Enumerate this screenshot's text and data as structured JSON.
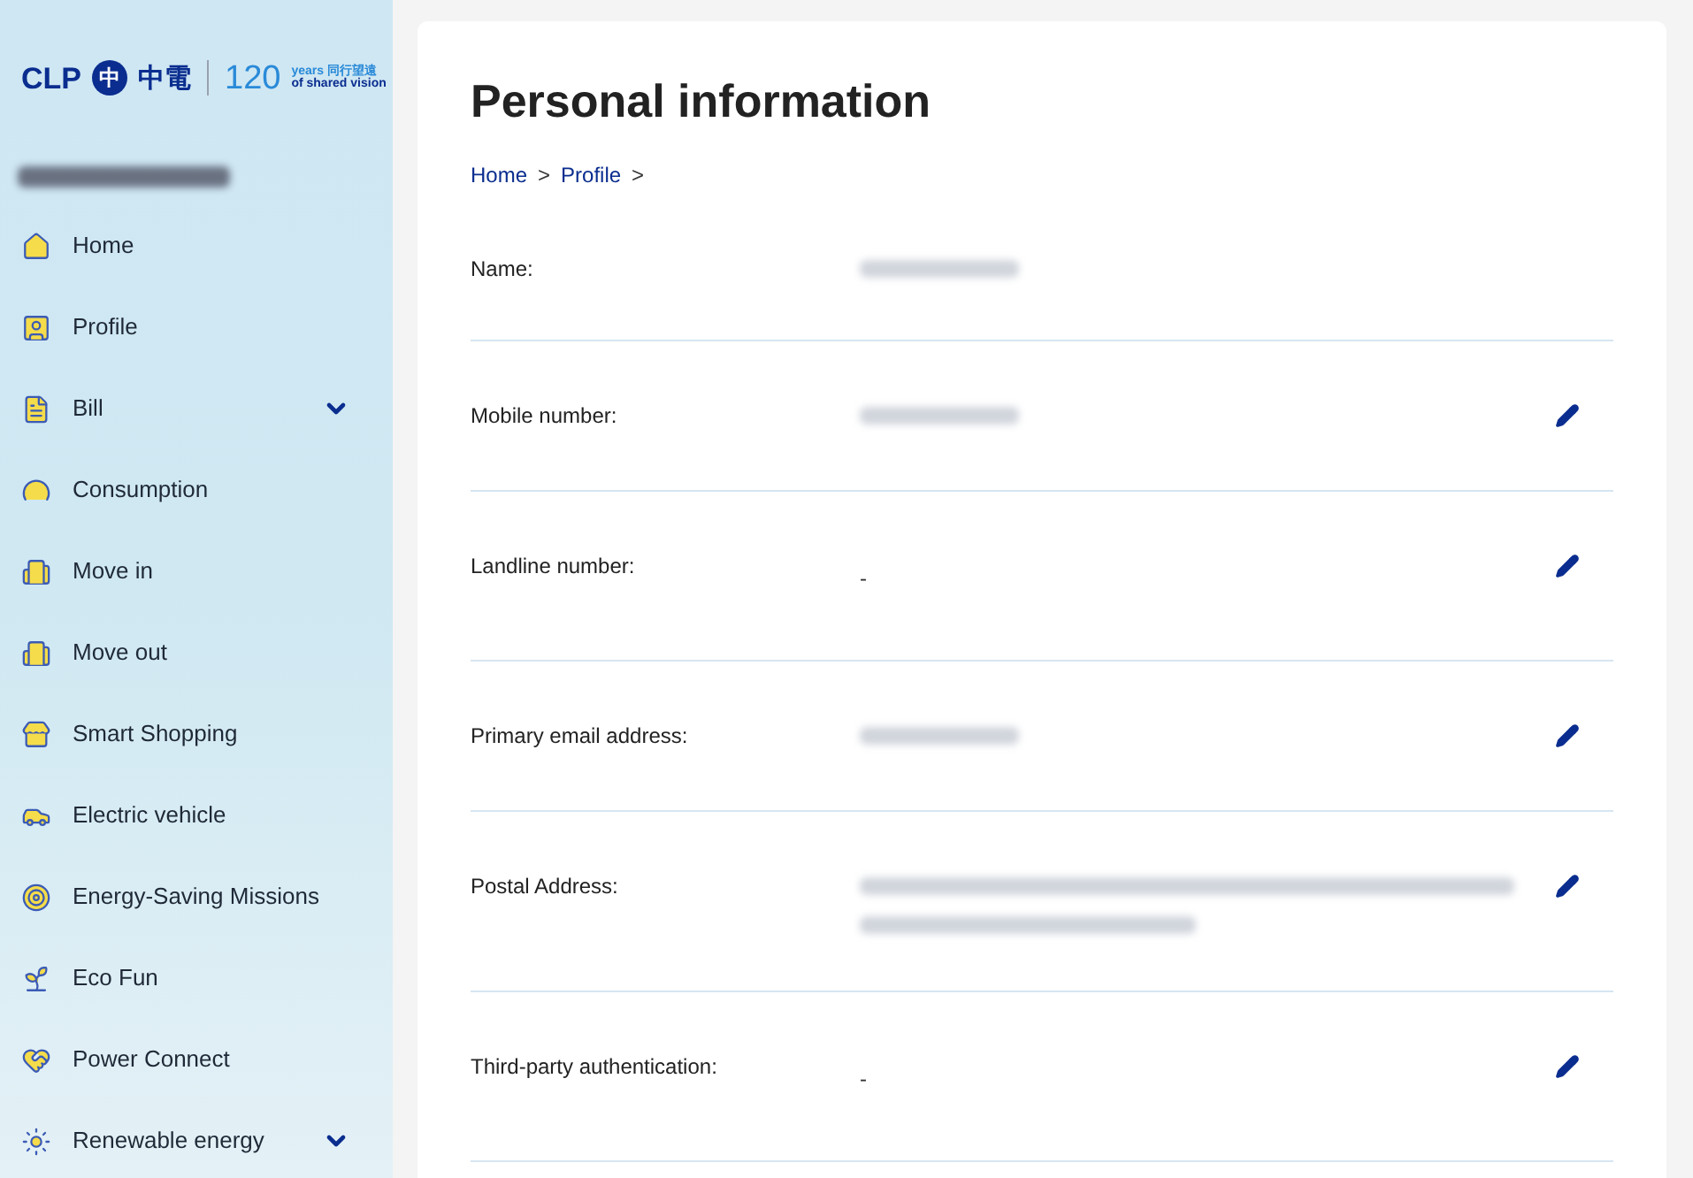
{
  "logo": {
    "brand": "CLP",
    "mark": "中",
    "chinese": "中電",
    "anniversary": "120",
    "tagline_top": "years 同行望遠",
    "tagline_bottom": "of shared vision"
  },
  "sidebar": {
    "items": [
      {
        "label": "Home",
        "kind": "link"
      },
      {
        "label": "Profile",
        "kind": "link"
      },
      {
        "label": "Bill",
        "kind": "group"
      },
      {
        "label": "Consumption",
        "kind": "link"
      },
      {
        "label": "Move in",
        "kind": "link"
      },
      {
        "label": "Move out",
        "kind": "link"
      },
      {
        "label": "Smart Shopping",
        "kind": "link"
      },
      {
        "label": "Electric vehicle",
        "kind": "link"
      },
      {
        "label": "Energy-Saving Missions",
        "kind": "link"
      },
      {
        "label": "Eco Fun",
        "kind": "link"
      },
      {
        "label": "Power Connect",
        "kind": "link"
      },
      {
        "label": "Renewable energy",
        "kind": "group"
      }
    ]
  },
  "page": {
    "title": "Personal information",
    "breadcrumb": [
      "Home",
      "Profile"
    ],
    "breadcrumb_separator": ">",
    "fields": [
      {
        "label": "Name:",
        "kind": "redacted",
        "editable": false
      },
      {
        "label": "Mobile number:",
        "kind": "redacted",
        "editable": true
      },
      {
        "label": "Landline number:",
        "kind": "text",
        "value": "-",
        "editable": true
      },
      {
        "label": "Primary email address:",
        "kind": "redacted",
        "editable": true
      },
      {
        "label": "Postal Address:",
        "kind": "redacted_multiline",
        "editable": true
      },
      {
        "label": "Third-party authentication:",
        "kind": "text",
        "value": "-",
        "editable": true
      }
    ]
  }
}
